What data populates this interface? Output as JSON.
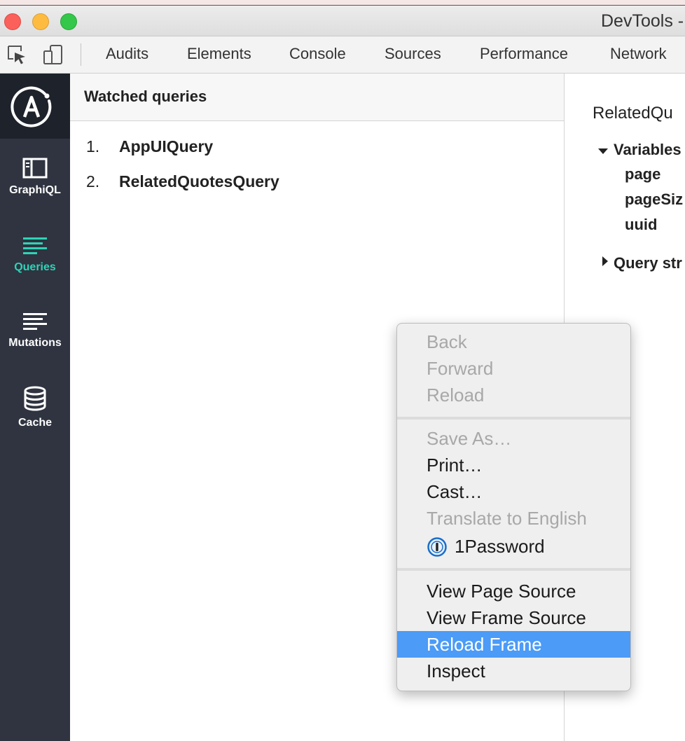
{
  "window": {
    "title": "DevTools -"
  },
  "toolbar": {
    "inspect_icon": "element-picker-icon",
    "device_icon": "device-toggle-icon",
    "tabs": [
      {
        "label": "Audits"
      },
      {
        "label": "Elements"
      },
      {
        "label": "Console"
      },
      {
        "label": "Sources"
      },
      {
        "label": "Performance"
      },
      {
        "label": "Network"
      }
    ]
  },
  "sidebar": {
    "logo": "apollo-logo-icon",
    "items": [
      {
        "label": "GraphiQL",
        "icon": "graphiql-icon",
        "active": false
      },
      {
        "label": "Queries",
        "icon": "queries-icon",
        "active": true
      },
      {
        "label": "Mutations",
        "icon": "mutations-icon",
        "active": false
      },
      {
        "label": "Cache",
        "icon": "database-icon",
        "active": false
      }
    ]
  },
  "watched": {
    "title": "Watched queries",
    "queries": [
      {
        "num": "1.",
        "name": "AppUIQuery"
      },
      {
        "num": "2.",
        "name": "RelatedQuotesQuery"
      }
    ]
  },
  "detail": {
    "title": "RelatedQu",
    "variables_label": "Variables",
    "variables": [
      "page",
      "pageSiz",
      "uuid"
    ],
    "query_label": "Query str"
  },
  "context_menu": {
    "groups": [
      [
        {
          "label": "Back",
          "enabled": false
        },
        {
          "label": "Forward",
          "enabled": false
        },
        {
          "label": "Reload",
          "enabled": false
        }
      ],
      [
        {
          "label": "Save As…",
          "enabled": false
        },
        {
          "label": "Print…",
          "enabled": true
        },
        {
          "label": "Cast…",
          "enabled": true
        },
        {
          "label": "Translate to English",
          "enabled": false
        },
        {
          "label": "1Password",
          "enabled": true,
          "icon": "1password-icon"
        }
      ],
      [
        {
          "label": "View Page Source",
          "enabled": true
        },
        {
          "label": "View Frame Source",
          "enabled": true
        },
        {
          "label": "Reload Frame",
          "enabled": true,
          "highlighted": true
        },
        {
          "label": "Inspect",
          "enabled": true
        }
      ]
    ]
  },
  "colors": {
    "sidebar_bg": "#2f3440",
    "accent": "#2ed3b7",
    "menu_highlight": "#4b9bf7"
  }
}
